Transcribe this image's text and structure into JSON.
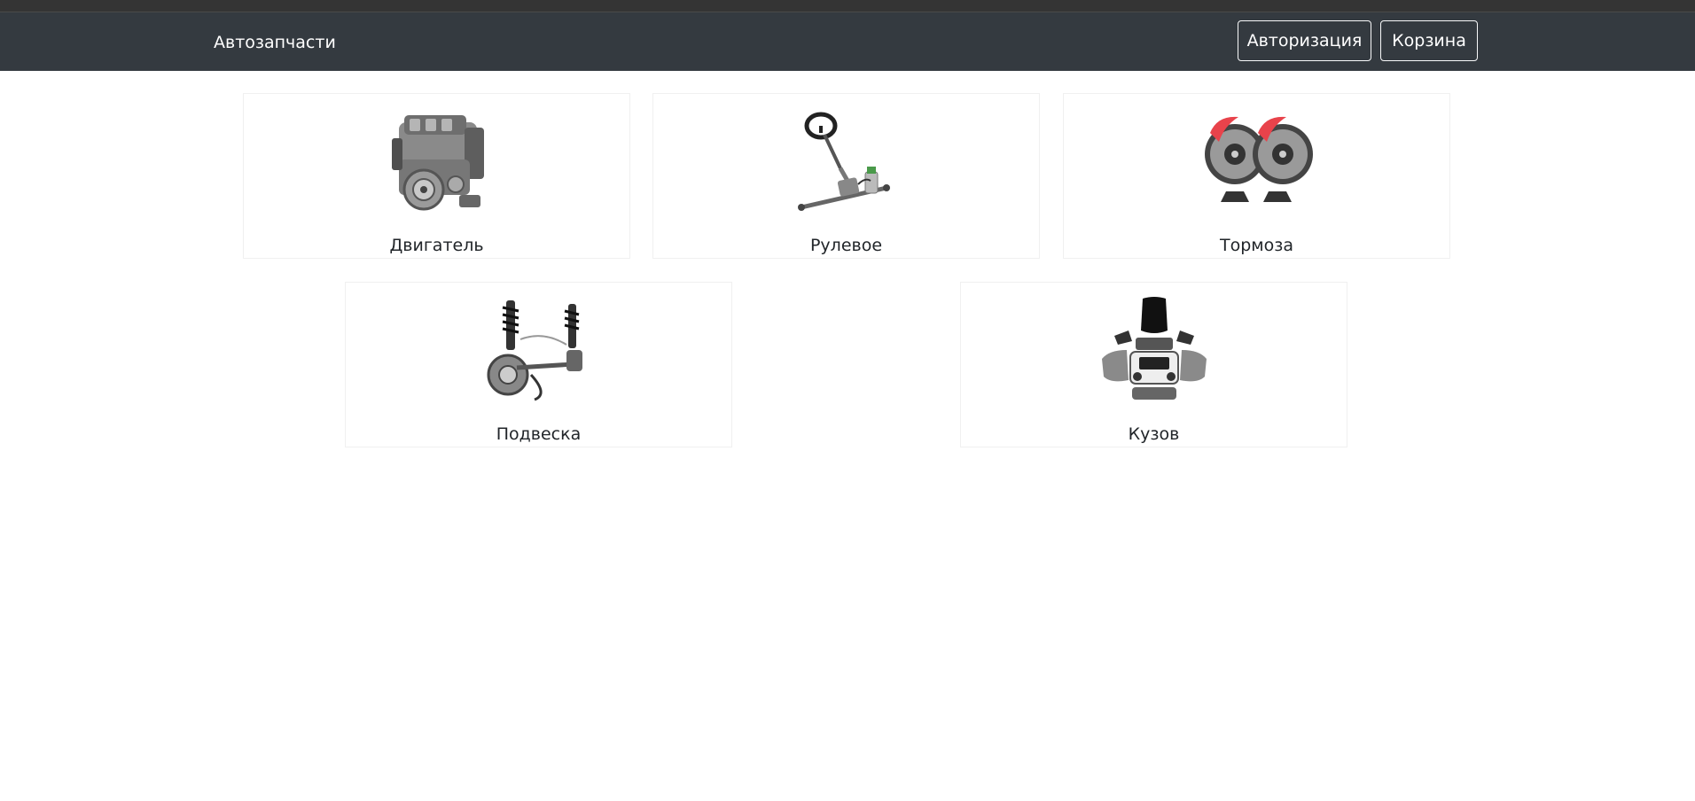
{
  "header": {
    "brand": "Автозапчасти",
    "login_label": "Авторизация",
    "cart_label": "Корзина"
  },
  "categories": [
    {
      "label": "Двигатель",
      "icon": "engine-icon"
    },
    {
      "label": "Рулевое",
      "icon": "steering-icon"
    },
    {
      "label": "Тормоза",
      "icon": "brakes-icon"
    },
    {
      "label": "Подвеска",
      "icon": "suspension-icon"
    },
    {
      "label": "Кузов",
      "icon": "body-parts-icon"
    }
  ],
  "colors": {
    "navbar": "#343a40",
    "top_strip": "#343434",
    "text": "#212529",
    "brake_caliper": "#e8434b"
  }
}
